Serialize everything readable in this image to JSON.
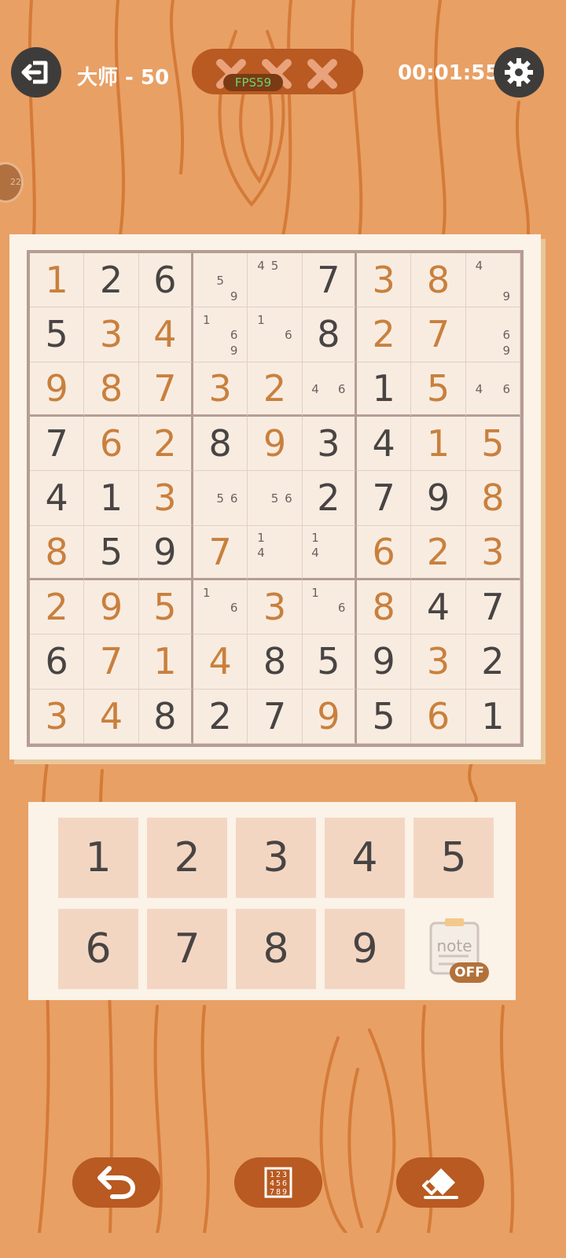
{
  "header": {
    "level": "大师 - 50",
    "timer": "00:01:55",
    "fps": "FPS59",
    "mistakes_count": 0,
    "mistakes_max": 3,
    "side_tab_text": "22"
  },
  "board": {
    "cells": [
      [
        {
          "v": "1",
          "t": "entered"
        },
        {
          "v": "2",
          "t": "given"
        },
        {
          "v": "6",
          "t": "given"
        },
        {
          "notes": [
            "5",
            "9"
          ],
          "pos": [
            5,
            9
          ]
        },
        {
          "notes": [
            "4",
            "5"
          ],
          "pos": [
            1,
            2
          ]
        },
        {
          "v": "7",
          "t": "given"
        },
        {
          "v": "3",
          "t": "entered"
        },
        {
          "v": "8",
          "t": "entered"
        },
        {
          "notes": [
            "4",
            "9"
          ],
          "pos": [
            1,
            9
          ]
        }
      ],
      [
        {
          "v": "5",
          "t": "given"
        },
        {
          "v": "3",
          "t": "entered"
        },
        {
          "v": "4",
          "t": "entered"
        },
        {
          "notes": [
            "1",
            "6",
            "9"
          ],
          "pos": [
            1,
            6,
            9
          ]
        },
        {
          "notes": [
            "1",
            "6"
          ],
          "pos": [
            1,
            6
          ]
        },
        {
          "v": "8",
          "t": "given"
        },
        {
          "v": "2",
          "t": "entered"
        },
        {
          "v": "7",
          "t": "entered"
        },
        {
          "notes": [
            "6",
            "9"
          ],
          "pos": [
            6,
            9
          ]
        }
      ],
      [
        {
          "v": "9",
          "t": "entered"
        },
        {
          "v": "8",
          "t": "entered"
        },
        {
          "v": "7",
          "t": "entered"
        },
        {
          "v": "3",
          "t": "entered"
        },
        {
          "v": "2",
          "t": "entered"
        },
        {
          "notes": [
            "4",
            "6"
          ],
          "pos": [
            4,
            6
          ]
        },
        {
          "v": "1",
          "t": "given"
        },
        {
          "v": "5",
          "t": "entered"
        },
        {
          "notes": [
            "4",
            "6"
          ],
          "pos": [
            4,
            6
          ]
        }
      ],
      [
        {
          "v": "7",
          "t": "given"
        },
        {
          "v": "6",
          "t": "entered"
        },
        {
          "v": "2",
          "t": "entered"
        },
        {
          "v": "8",
          "t": "given"
        },
        {
          "v": "9",
          "t": "entered"
        },
        {
          "v": "3",
          "t": "given"
        },
        {
          "v": "4",
          "t": "given"
        },
        {
          "v": "1",
          "t": "entered"
        },
        {
          "v": "5",
          "t": "entered"
        }
      ],
      [
        {
          "v": "4",
          "t": "given"
        },
        {
          "v": "1",
          "t": "given"
        },
        {
          "v": "3",
          "t": "entered"
        },
        {
          "notes": [
            "5",
            "6"
          ],
          "pos": [
            5,
            6
          ]
        },
        {
          "notes": [
            "5",
            "6"
          ],
          "pos": [
            5,
            6
          ]
        },
        {
          "v": "2",
          "t": "given"
        },
        {
          "v": "7",
          "t": "given"
        },
        {
          "v": "9",
          "t": "given"
        },
        {
          "v": "8",
          "t": "entered"
        }
      ],
      [
        {
          "v": "8",
          "t": "entered"
        },
        {
          "v": "5",
          "t": "given"
        },
        {
          "v": "9",
          "t": "given"
        },
        {
          "v": "7",
          "t": "entered"
        },
        {
          "notes": [
            "1",
            "4"
          ],
          "pos": [
            1,
            4
          ]
        },
        {
          "notes": [
            "1",
            "4"
          ],
          "pos": [
            1,
            4
          ]
        },
        {
          "v": "6",
          "t": "entered"
        },
        {
          "v": "2",
          "t": "entered"
        },
        {
          "v": "3",
          "t": "entered"
        }
      ],
      [
        {
          "v": "2",
          "t": "entered"
        },
        {
          "v": "9",
          "t": "entered"
        },
        {
          "v": "5",
          "t": "entered"
        },
        {
          "notes": [
            "1",
            "6"
          ],
          "pos": [
            1,
            6
          ]
        },
        {
          "v": "3",
          "t": "entered"
        },
        {
          "notes": [
            "1",
            "6"
          ],
          "pos": [
            1,
            6
          ]
        },
        {
          "v": "8",
          "t": "entered"
        },
        {
          "v": "4",
          "t": "given"
        },
        {
          "v": "7",
          "t": "given"
        }
      ],
      [
        {
          "v": "6",
          "t": "given"
        },
        {
          "v": "7",
          "t": "entered"
        },
        {
          "v": "1",
          "t": "entered"
        },
        {
          "v": "4",
          "t": "entered"
        },
        {
          "v": "8",
          "t": "given"
        },
        {
          "v": "5",
          "t": "given"
        },
        {
          "v": "9",
          "t": "given"
        },
        {
          "v": "3",
          "t": "entered"
        },
        {
          "v": "2",
          "t": "given"
        }
      ],
      [
        {
          "v": "3",
          "t": "entered"
        },
        {
          "v": "4",
          "t": "entered"
        },
        {
          "v": "8",
          "t": "given"
        },
        {
          "v": "2",
          "t": "given"
        },
        {
          "v": "7",
          "t": "given"
        },
        {
          "v": "9",
          "t": "entered"
        },
        {
          "v": "5",
          "t": "given"
        },
        {
          "v": "6",
          "t": "entered"
        },
        {
          "v": "1",
          "t": "given"
        }
      ]
    ]
  },
  "keypad": {
    "keys": [
      "1",
      "2",
      "3",
      "4",
      "5",
      "6",
      "7",
      "8",
      "9"
    ],
    "note_label": "note",
    "note_state": "OFF"
  },
  "toolbar": {
    "undo_icon": "undo-arrow",
    "candidates_icon": "number-grid",
    "erase_icon": "eraser"
  },
  "colors": {
    "background": "#e8a065",
    "given_digit": "#484443",
    "entered_digit": "#c9803d",
    "button_dark": "#3e3c3b",
    "button_brown": "#b85a21"
  }
}
